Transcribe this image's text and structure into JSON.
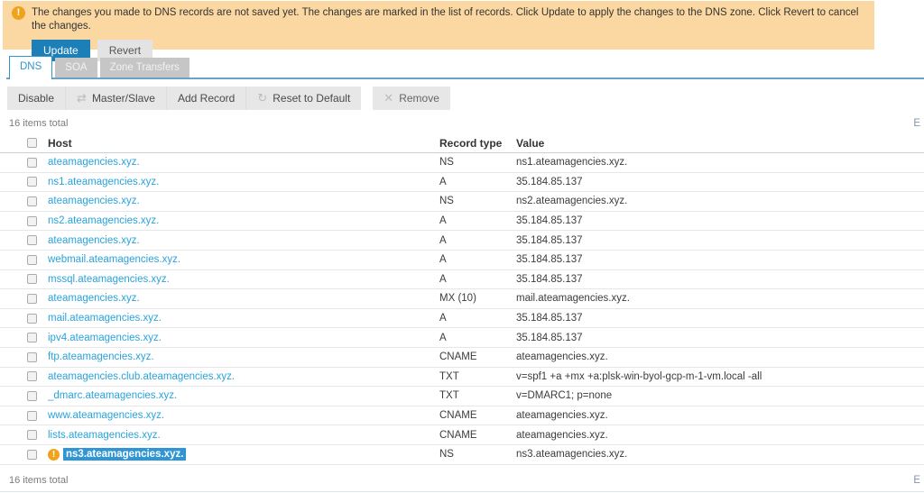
{
  "banner": {
    "message": "The changes you made to DNS records are not saved yet. The changes are marked in the list of records. Click Update to apply the changes to the DNS zone. Click Revert to cancel the changes.",
    "warning_icon": "exclamation-in-circle",
    "update_label": "Update",
    "revert_label": "Revert"
  },
  "tabs": [
    {
      "label": "DNS",
      "active": true
    },
    {
      "label": "SOA",
      "active": false
    },
    {
      "label": "Zone Transfers",
      "active": false
    }
  ],
  "toolbar": {
    "disable_label": "Disable",
    "master_slave_label": "Master/Slave",
    "master_slave_icon": "swap-arrows",
    "add_record_label": "Add Record",
    "reset_label": "Reset to Default",
    "reset_icon": "circular-refresh-arrow",
    "remove_label": "Remove",
    "remove_icon": "x-cross"
  },
  "icons": {
    "swap_glyph": "⇄",
    "reset_glyph": "↻",
    "remove_glyph": "✕",
    "warning_glyph": "!"
  },
  "items_total_top": "16 items total",
  "items_total_bottom": "16 items total",
  "pagination_truncated": "E",
  "table": {
    "columns": {
      "host": "Host",
      "record_type": "Record type",
      "value": "Value"
    },
    "rows": [
      {
        "host": "ateamagencies.xyz.",
        "type": "NS",
        "value": "ns1.ateamagencies.xyz.",
        "modified": false
      },
      {
        "host": "ns1.ateamagencies.xyz.",
        "type": "A",
        "value": "35.184.85.137",
        "modified": false
      },
      {
        "host": "ateamagencies.xyz.",
        "type": "NS",
        "value": "ns2.ateamagencies.xyz.",
        "modified": false
      },
      {
        "host": "ns2.ateamagencies.xyz.",
        "type": "A",
        "value": "35.184.85.137",
        "modified": false
      },
      {
        "host": "ateamagencies.xyz.",
        "type": "A",
        "value": "35.184.85.137",
        "modified": false
      },
      {
        "host": "webmail.ateamagencies.xyz.",
        "type": "A",
        "value": "35.184.85.137",
        "modified": false
      },
      {
        "host": "mssql.ateamagencies.xyz.",
        "type": "A",
        "value": "35.184.85.137",
        "modified": false
      },
      {
        "host": "ateamagencies.xyz.",
        "type": "MX (10)",
        "value": "mail.ateamagencies.xyz.",
        "modified": false
      },
      {
        "host": "mail.ateamagencies.xyz.",
        "type": "A",
        "value": "35.184.85.137",
        "modified": false
      },
      {
        "host": "ipv4.ateamagencies.xyz.",
        "type": "A",
        "value": "35.184.85.137",
        "modified": false
      },
      {
        "host": "ftp.ateamagencies.xyz.",
        "type": "CNAME",
        "value": "ateamagencies.xyz.",
        "modified": false
      },
      {
        "host": "ateamagencies.club.ateamagencies.xyz.",
        "type": "TXT",
        "value": "v=spf1 +a +mx +a:plsk-win-byol-gcp-m-1-vm.local -all",
        "modified": false
      },
      {
        "host": "_dmarc.ateamagencies.xyz.",
        "type": "TXT",
        "value": "v=DMARC1; p=none",
        "modified": false
      },
      {
        "host": "www.ateamagencies.xyz.",
        "type": "CNAME",
        "value": "ateamagencies.xyz.",
        "modified": false
      },
      {
        "host": "lists.ateamagencies.xyz.",
        "type": "CNAME",
        "value": "ateamagencies.xyz.",
        "modified": false
      },
      {
        "host": "ns3.ateamagencies.xyz.",
        "type": "NS",
        "value": "ns3.ateamagencies.xyz.",
        "modified": true
      }
    ]
  },
  "colors": {
    "banner_bg": "#fbd7a1",
    "warning_orange": "#efa31d",
    "primary_button_blue": "#1d7fb8",
    "tab_accent_blue": "#2f96cc",
    "tab_underline_blue": "#6ba3c6",
    "link_blue": "#29a3dc",
    "selection_blue": "#3095d6",
    "toolbar_gray": "#e7e7e7"
  }
}
